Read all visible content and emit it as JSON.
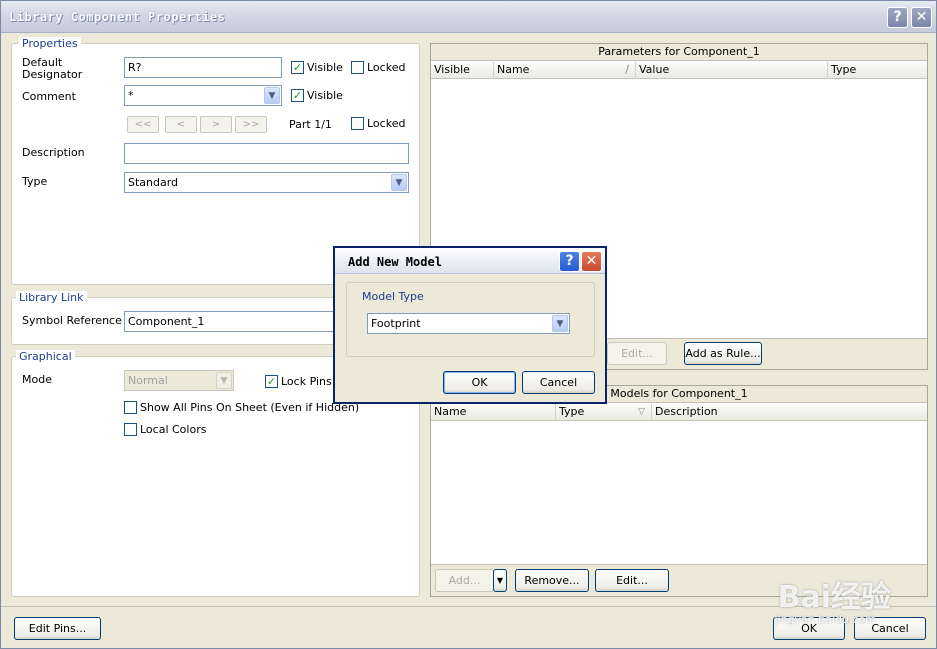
{
  "window": {
    "title": "Library Component Properties",
    "help_glyph": "?",
    "close_glyph": "✕"
  },
  "properties": {
    "group_label": "Properties",
    "default_designator_label": "Default\nDesignator",
    "default_designator_value": "R?",
    "visible1_label": "Visible",
    "locked1_label": "Locked",
    "comment_label": "Comment",
    "comment_value": "*",
    "visible2_label": "Visible",
    "nav_first": "<<",
    "nav_prev": "<",
    "nav_next": ">",
    "nav_last": ">>",
    "part_label": "Part 1/1",
    "locked2_label": "Locked",
    "description_label": "Description",
    "description_value": "",
    "type_label": "Type",
    "type_value": "Standard"
  },
  "library_link": {
    "group_label": "Library Link",
    "symbol_reference_label": "Symbol Reference",
    "symbol_reference_value": "Component_1"
  },
  "graphical": {
    "group_label": "Graphical",
    "mode_label": "Mode",
    "mode_value": "Normal",
    "lock_pins_label": "Lock Pins",
    "show_all_pins_label": "Show All Pins On Sheet (Even if Hidden)",
    "local_colors_label": "Local Colors"
  },
  "parameters": {
    "title": "Parameters for Component_1",
    "columns": [
      "Visible",
      "Name",
      "Value",
      "Type"
    ],
    "sort_glyph": "/",
    "edit_button": "Edit...",
    "add_rule_button": "Add as Rule..."
  },
  "models": {
    "title": "Models for Component_1",
    "columns": [
      "Name",
      "Type",
      "Description"
    ],
    "sort_glyph": "▽",
    "add_button": "Add...",
    "remove_button": "Remove...",
    "edit_button": "Edit..."
  },
  "footer": {
    "edit_pins_button": "Edit Pins...",
    "ok_button": "OK",
    "cancel_button": "Cancel"
  },
  "dialog": {
    "title": "Add New Model",
    "help_glyph": "?",
    "close_glyph": "✕",
    "model_type_label": "Model Type",
    "model_type_value": "Footprint",
    "ok_button": "OK",
    "cancel_button": "Cancel"
  },
  "watermark": {
    "brand": "Bai经验",
    "url": "jingyan.baidu.com"
  }
}
